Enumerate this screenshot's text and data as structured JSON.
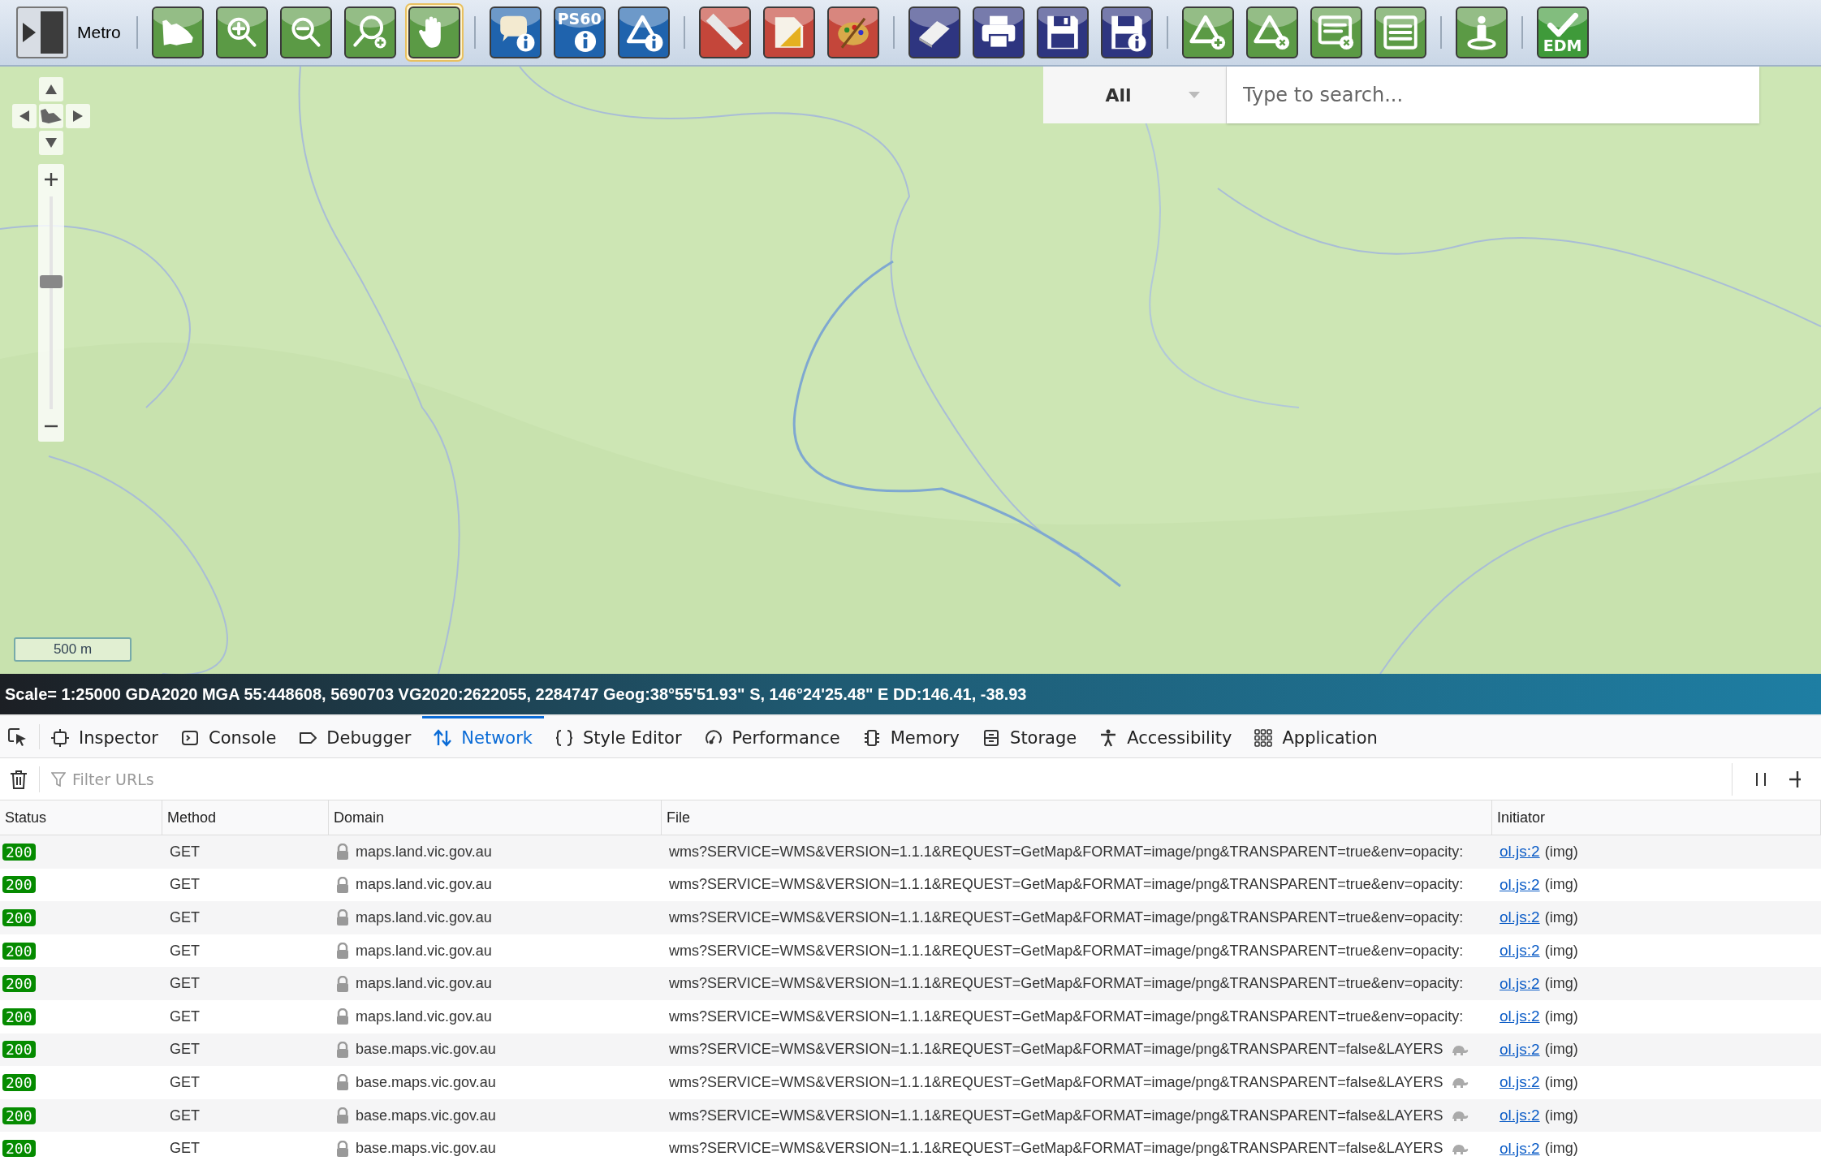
{
  "toolbar": {
    "location_label": "Metro",
    "groups": [
      {
        "color": "#5b9a45",
        "buttons": [
          {
            "selected": false
          },
          {
            "selected": false
          },
          {
            "selected": false
          },
          {
            "selected": false
          },
          {
            "selected": true
          }
        ]
      },
      {
        "color": "#1f63ad",
        "buttons": [
          {
            "selected": false
          },
          {
            "label": "PS60",
            "selected": false
          },
          {
            "selected": false
          }
        ]
      },
      {
        "color": "#c4463a",
        "buttons": [
          {
            "selected": false
          },
          {
            "selected": false
          },
          {
            "selected": false
          }
        ]
      },
      {
        "color": "#2e3580",
        "buttons": [
          {
            "selected": false
          },
          {
            "selected": false
          },
          {
            "selected": false
          },
          {
            "selected": false
          }
        ]
      },
      {
        "color": "#5b9a45",
        "buttons": [
          {
            "selected": false
          },
          {
            "selected": false
          },
          {
            "selected": false
          },
          {
            "selected": false
          }
        ]
      },
      {
        "color": "#5b9a45",
        "buttons": [
          {
            "selected": false
          }
        ]
      },
      {
        "color": "#3f9a3a",
        "buttons": [
          {
            "label": "EDM",
            "selected": false
          }
        ]
      }
    ]
  },
  "search": {
    "scope": "All",
    "placeholder": "Type to search..."
  },
  "map": {
    "zoom_slider": {
      "level": 0.6
    },
    "scale_bar": "500 m"
  },
  "status_bar": "Scale= 1:25000 GDA2020 MGA 55:448608, 5690703 VG2020:2622055, 2284747 Geog:38°55'51.93\" S, 146°24'25.48\" E DD:146.41, -38.93",
  "devtools": {
    "tabs": [
      {
        "label": "Inspector",
        "selected": false
      },
      {
        "label": "Console",
        "selected": false
      },
      {
        "label": "Debugger",
        "selected": false
      },
      {
        "label": "Network",
        "selected": true
      },
      {
        "label": "Style Editor",
        "selected": false
      },
      {
        "label": "Performance",
        "selected": false
      },
      {
        "label": "Memory",
        "selected": false
      },
      {
        "label": "Storage",
        "selected": false
      },
      {
        "label": "Accessibility",
        "selected": false
      },
      {
        "label": "Application",
        "selected": false
      }
    ],
    "filter": {
      "placeholder": "Filter URLs"
    },
    "table": {
      "columns": [
        "Status",
        "Method",
        "Domain",
        "File",
        "Initiator"
      ],
      "rows": [
        {
          "status": "200",
          "method": "GET",
          "domain": "maps.land.vic.gov.au",
          "file": "wms?SERVICE=WMS&VERSION=1.1.1&REQUEST=GetMap&FORMAT=image/png&TRANSPARENT=true&env=opacity:",
          "slow": false,
          "initiator": "ol.js:2",
          "initiator_type": "(img)"
        },
        {
          "status": "200",
          "method": "GET",
          "domain": "maps.land.vic.gov.au",
          "file": "wms?SERVICE=WMS&VERSION=1.1.1&REQUEST=GetMap&FORMAT=image/png&TRANSPARENT=true&env=opacity:",
          "slow": false,
          "initiator": "ol.js:2",
          "initiator_type": "(img)"
        },
        {
          "status": "200",
          "method": "GET",
          "domain": "maps.land.vic.gov.au",
          "file": "wms?SERVICE=WMS&VERSION=1.1.1&REQUEST=GetMap&FORMAT=image/png&TRANSPARENT=true&env=opacity:",
          "slow": false,
          "initiator": "ol.js:2",
          "initiator_type": "(img)"
        },
        {
          "status": "200",
          "method": "GET",
          "domain": "maps.land.vic.gov.au",
          "file": "wms?SERVICE=WMS&VERSION=1.1.1&REQUEST=GetMap&FORMAT=image/png&TRANSPARENT=true&env=opacity:",
          "slow": false,
          "initiator": "ol.js:2",
          "initiator_type": "(img)"
        },
        {
          "status": "200",
          "method": "GET",
          "domain": "maps.land.vic.gov.au",
          "file": "wms?SERVICE=WMS&VERSION=1.1.1&REQUEST=GetMap&FORMAT=image/png&TRANSPARENT=true&env=opacity:",
          "slow": false,
          "initiator": "ol.js:2",
          "initiator_type": "(img)"
        },
        {
          "status": "200",
          "method": "GET",
          "domain": "maps.land.vic.gov.au",
          "file": "wms?SERVICE=WMS&VERSION=1.1.1&REQUEST=GetMap&FORMAT=image/png&TRANSPARENT=true&env=opacity:",
          "slow": false,
          "initiator": "ol.js:2",
          "initiator_type": "(img)"
        },
        {
          "status": "200",
          "method": "GET",
          "domain": "base.maps.vic.gov.au",
          "file": "wms?SERVICE=WMS&VERSION=1.1.1&REQUEST=GetMap&FORMAT=image/png&TRANSPARENT=false&LAYERS",
          "slow": true,
          "initiator": "ol.js:2",
          "initiator_type": "(img)"
        },
        {
          "status": "200",
          "method": "GET",
          "domain": "base.maps.vic.gov.au",
          "file": "wms?SERVICE=WMS&VERSION=1.1.1&REQUEST=GetMap&FORMAT=image/png&TRANSPARENT=false&LAYERS",
          "slow": true,
          "initiator": "ol.js:2",
          "initiator_type": "(img)"
        },
        {
          "status": "200",
          "method": "GET",
          "domain": "base.maps.vic.gov.au",
          "file": "wms?SERVICE=WMS&VERSION=1.1.1&REQUEST=GetMap&FORMAT=image/png&TRANSPARENT=false&LAYERS",
          "slow": true,
          "initiator": "ol.js:2",
          "initiator_type": "(img)"
        },
        {
          "status": "200",
          "method": "GET",
          "domain": "base.maps.vic.gov.au",
          "file": "wms?SERVICE=WMS&VERSION=1.1.1&REQUEST=GetMap&FORMAT=image/png&TRANSPARENT=false&LAYERS",
          "slow": true,
          "initiator": "ol.js:2",
          "initiator_type": "(img)"
        }
      ]
    }
  }
}
